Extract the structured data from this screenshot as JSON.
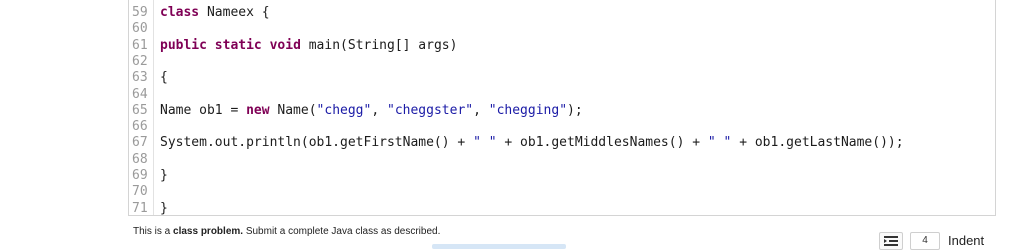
{
  "editor": {
    "lines": [
      {
        "n": "59",
        "code": "class Nameex {"
      },
      {
        "n": "60",
        "code": ""
      },
      {
        "n": "61",
        "code": "public static void main(String[] args)"
      },
      {
        "n": "62",
        "code": ""
      },
      {
        "n": "63",
        "code": "{"
      },
      {
        "n": "64",
        "code": ""
      },
      {
        "n": "65",
        "code": "Name ob1 = new Name(\"chegg\", \"cheggster\", \"chegging\");"
      },
      {
        "n": "66",
        "code": ""
      },
      {
        "n": "67",
        "code": "System.out.println(ob1.getFirstName() + \" \" + ob1.getMiddlesNames() + \" \" + ob1.getLastName());"
      },
      {
        "n": "68",
        "code": ""
      },
      {
        "n": "69",
        "code": "}"
      },
      {
        "n": "70",
        "code": ""
      },
      {
        "n": "71",
        "code": "}"
      }
    ]
  },
  "problem": {
    "prefix": "This is a ",
    "bold": "class problem.",
    "suffix": " Submit a complete Java class as described."
  },
  "footer": {
    "indent_icon": "indent-icon",
    "indent_value": "4",
    "indent_label": "Indent"
  }
}
